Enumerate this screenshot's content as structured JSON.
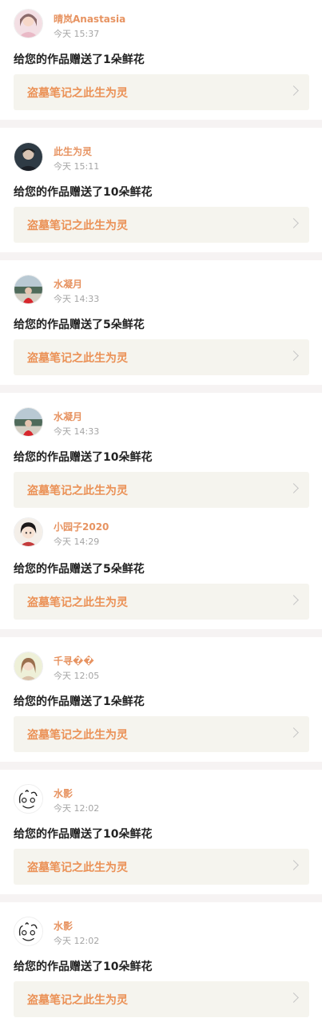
{
  "message_prefix": "给您的作品赠送了",
  "message_suffix": "朵鲜花",
  "work_title": "盗墓笔记之此生为灵",
  "cards": [
    {
      "entries": [
        {
          "username": "晴岚Anastasia",
          "time": "今天 15:37",
          "count": "1",
          "message": "给您的作品赠送了1朵鲜花",
          "work": "盗墓笔记之此生为灵",
          "avatar": "avatar-girl-pink"
        }
      ]
    },
    {
      "entries": [
        {
          "username": "此生为灵",
          "time": "今天 15:11",
          "count": "10",
          "message": "给您的作品赠送了10朵鲜花",
          "work": "盗墓笔记之此生为灵",
          "avatar": "avatar-boy-dark"
        }
      ]
    },
    {
      "entries": [
        {
          "username": "水凝月",
          "time": "今天 14:33",
          "count": "5",
          "message": "给您的作品赠送了5朵鲜花",
          "work": "盗墓笔记之此生为灵",
          "avatar": "avatar-landscape-red"
        }
      ]
    },
    {
      "entries": [
        {
          "username": "水凝月",
          "time": "今天 14:33",
          "count": "10",
          "message": "给您的作品赠送了10朵鲜花",
          "work": "盗墓笔记之此生为灵",
          "avatar": "avatar-landscape-red"
        },
        {
          "username": "小园子2020",
          "time": "今天 14:29",
          "count": "5",
          "message": "给您的作品赠送了5朵鲜花",
          "work": "盗墓笔记之此生为灵",
          "avatar": "avatar-cartoon-girl"
        }
      ]
    },
    {
      "entries": [
        {
          "username": "千寻��",
          "time": "今天 12:05",
          "count": "1",
          "message": "给您的作品赠送了1朵鲜花",
          "work": "盗墓笔记之此生为灵",
          "avatar": "avatar-girl-sketch"
        }
      ]
    },
    {
      "entries": [
        {
          "username": "水影",
          "time": "今天 12:02",
          "count": "10",
          "message": "给您的作品赠送了10朵鲜花",
          "work": "盗墓笔记之此生为灵",
          "avatar": "avatar-doodle"
        }
      ]
    },
    {
      "entries": [
        {
          "username": "水影",
          "time": "今天 12:02",
          "count": "10",
          "message": "给您的作品赠送了10朵鲜花",
          "work": "盗墓笔记之此生为灵",
          "avatar": "avatar-doodle"
        }
      ]
    }
  ],
  "colors": {
    "username": "#e79361",
    "work_title": "#eb9156",
    "link_bg": "#f5f4ee",
    "separator": "#f6f3f3"
  }
}
